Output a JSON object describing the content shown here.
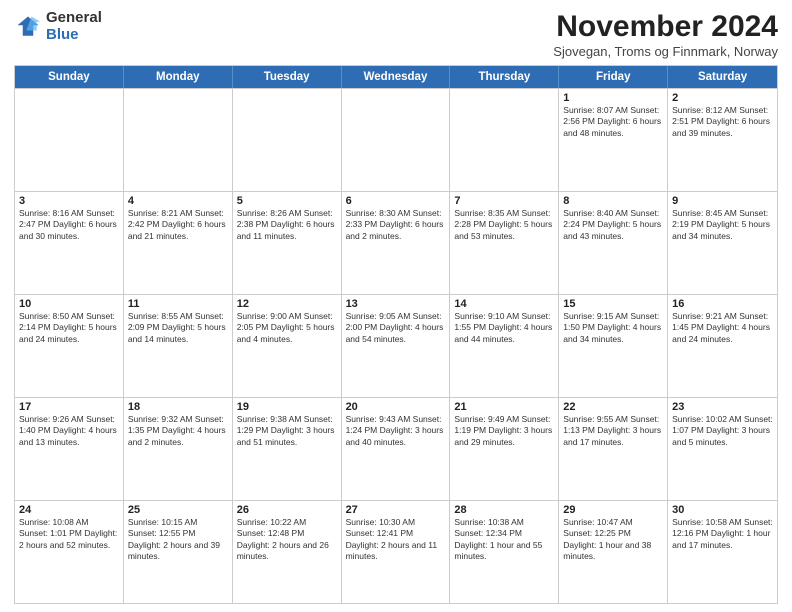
{
  "logo": {
    "general": "General",
    "blue": "Blue"
  },
  "header": {
    "title": "November 2024",
    "subtitle": "Sjovegan, Troms og Finnmark, Norway"
  },
  "days_of_week": [
    "Sunday",
    "Monday",
    "Tuesday",
    "Wednesday",
    "Thursday",
    "Friday",
    "Saturday"
  ],
  "weeks": [
    [
      {
        "day": "",
        "info": ""
      },
      {
        "day": "",
        "info": ""
      },
      {
        "day": "",
        "info": ""
      },
      {
        "day": "",
        "info": ""
      },
      {
        "day": "",
        "info": ""
      },
      {
        "day": "1",
        "info": "Sunrise: 8:07 AM\nSunset: 2:56 PM\nDaylight: 6 hours and 48 minutes."
      },
      {
        "day": "2",
        "info": "Sunrise: 8:12 AM\nSunset: 2:51 PM\nDaylight: 6 hours and 39 minutes."
      }
    ],
    [
      {
        "day": "3",
        "info": "Sunrise: 8:16 AM\nSunset: 2:47 PM\nDaylight: 6 hours and 30 minutes."
      },
      {
        "day": "4",
        "info": "Sunrise: 8:21 AM\nSunset: 2:42 PM\nDaylight: 6 hours and 21 minutes."
      },
      {
        "day": "5",
        "info": "Sunrise: 8:26 AM\nSunset: 2:38 PM\nDaylight: 6 hours and 11 minutes."
      },
      {
        "day": "6",
        "info": "Sunrise: 8:30 AM\nSunset: 2:33 PM\nDaylight: 6 hours and 2 minutes."
      },
      {
        "day": "7",
        "info": "Sunrise: 8:35 AM\nSunset: 2:28 PM\nDaylight: 5 hours and 53 minutes."
      },
      {
        "day": "8",
        "info": "Sunrise: 8:40 AM\nSunset: 2:24 PM\nDaylight: 5 hours and 43 minutes."
      },
      {
        "day": "9",
        "info": "Sunrise: 8:45 AM\nSunset: 2:19 PM\nDaylight: 5 hours and 34 minutes."
      }
    ],
    [
      {
        "day": "10",
        "info": "Sunrise: 8:50 AM\nSunset: 2:14 PM\nDaylight: 5 hours and 24 minutes."
      },
      {
        "day": "11",
        "info": "Sunrise: 8:55 AM\nSunset: 2:09 PM\nDaylight: 5 hours and 14 minutes."
      },
      {
        "day": "12",
        "info": "Sunrise: 9:00 AM\nSunset: 2:05 PM\nDaylight: 5 hours and 4 minutes."
      },
      {
        "day": "13",
        "info": "Sunrise: 9:05 AM\nSunset: 2:00 PM\nDaylight: 4 hours and 54 minutes."
      },
      {
        "day": "14",
        "info": "Sunrise: 9:10 AM\nSunset: 1:55 PM\nDaylight: 4 hours and 44 minutes."
      },
      {
        "day": "15",
        "info": "Sunrise: 9:15 AM\nSunset: 1:50 PM\nDaylight: 4 hours and 34 minutes."
      },
      {
        "day": "16",
        "info": "Sunrise: 9:21 AM\nSunset: 1:45 PM\nDaylight: 4 hours and 24 minutes."
      }
    ],
    [
      {
        "day": "17",
        "info": "Sunrise: 9:26 AM\nSunset: 1:40 PM\nDaylight: 4 hours and 13 minutes."
      },
      {
        "day": "18",
        "info": "Sunrise: 9:32 AM\nSunset: 1:35 PM\nDaylight: 4 hours and 2 minutes."
      },
      {
        "day": "19",
        "info": "Sunrise: 9:38 AM\nSunset: 1:29 PM\nDaylight: 3 hours and 51 minutes."
      },
      {
        "day": "20",
        "info": "Sunrise: 9:43 AM\nSunset: 1:24 PM\nDaylight: 3 hours and 40 minutes."
      },
      {
        "day": "21",
        "info": "Sunrise: 9:49 AM\nSunset: 1:19 PM\nDaylight: 3 hours and 29 minutes."
      },
      {
        "day": "22",
        "info": "Sunrise: 9:55 AM\nSunset: 1:13 PM\nDaylight: 3 hours and 17 minutes."
      },
      {
        "day": "23",
        "info": "Sunrise: 10:02 AM\nSunset: 1:07 PM\nDaylight: 3 hours and 5 minutes."
      }
    ],
    [
      {
        "day": "24",
        "info": "Sunrise: 10:08 AM\nSunset: 1:01 PM\nDaylight: 2 hours and 52 minutes."
      },
      {
        "day": "25",
        "info": "Sunrise: 10:15 AM\nSunset: 12:55 PM\nDaylight: 2 hours and 39 minutes."
      },
      {
        "day": "26",
        "info": "Sunrise: 10:22 AM\nSunset: 12:48 PM\nDaylight: 2 hours and 26 minutes."
      },
      {
        "day": "27",
        "info": "Sunrise: 10:30 AM\nSunset: 12:41 PM\nDaylight: 2 hours and 11 minutes."
      },
      {
        "day": "28",
        "info": "Sunrise: 10:38 AM\nSunset: 12:34 PM\nDaylight: 1 hour and 55 minutes."
      },
      {
        "day": "29",
        "info": "Sunrise: 10:47 AM\nSunset: 12:25 PM\nDaylight: 1 hour and 38 minutes."
      },
      {
        "day": "30",
        "info": "Sunrise: 10:58 AM\nSunset: 12:16 PM\nDaylight: 1 hour and 17 minutes."
      }
    ]
  ]
}
